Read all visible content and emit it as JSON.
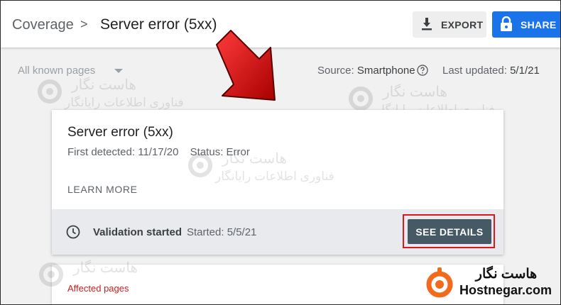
{
  "header": {
    "breadcrumb_root": "Coverage",
    "breadcrumb_separator": ">",
    "breadcrumb_current": "Server error (5xx)",
    "export_label": "EXPORT",
    "share_label": "SHARE",
    "export_icon": "download-icon",
    "share_icon": "lock-icon"
  },
  "filters": {
    "select_value": "All known pages",
    "source_label": "Source:",
    "source_value": "Smartphone",
    "updated_label": "Last updated:",
    "updated_value": "5/1/21"
  },
  "card": {
    "title": "Server error (5xx)",
    "first_detected_label": "First detected:",
    "first_detected_value": "11/17/20",
    "status_label": "Status:",
    "status_value": "Error",
    "learn_more": "LEARN MORE",
    "validation_status": "Validation started",
    "validation_started": "Started: 5/5/21",
    "see_details": "SEE DETAILS"
  },
  "card2": {
    "affected_pages": "Affected pages"
  },
  "watermark": {
    "line1": "هاست نگار",
    "line2": "فناوری اطلاعات رایانگار"
  },
  "brand": {
    "name_fa": "هاست نگار",
    "name_en": "Hostnegar.com"
  },
  "colors": {
    "primary": "#1a73e8",
    "details_button": "#455a64",
    "highlight": "#e0161e",
    "affected_text": "#c5221f"
  }
}
